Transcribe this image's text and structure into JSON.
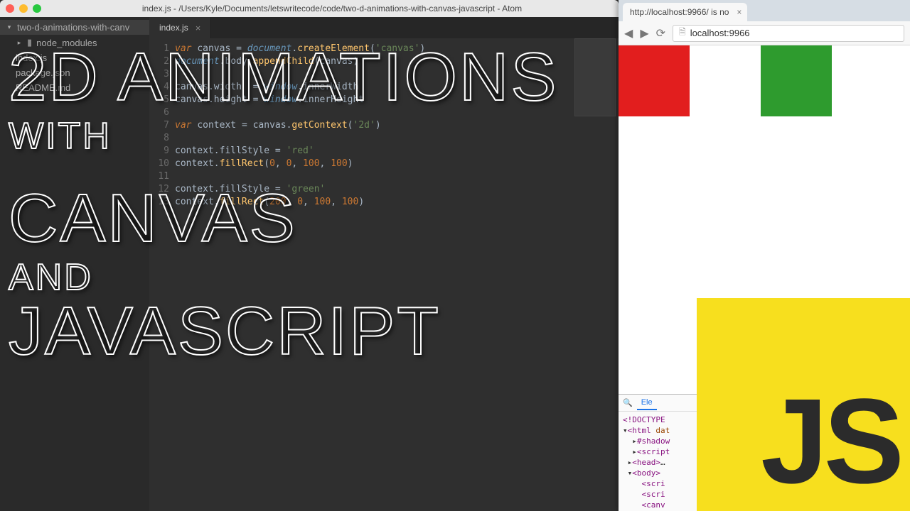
{
  "atom": {
    "title": "index.js - /Users/Kyle/Documents/letswritecode/code/two-d-animations-with-canvas-javascript - Atom",
    "sidebar": {
      "project": "two-d-animations-with-canv",
      "items": [
        {
          "name": "node_modules",
          "type": "folder"
        },
        {
          "name": "index.js",
          "type": "file"
        },
        {
          "name": "package.json",
          "type": "file"
        },
        {
          "name": "README.md",
          "type": "file"
        }
      ]
    },
    "tab": {
      "name": "index.js",
      "close": "×"
    },
    "code_lines": [
      "var canvas = document.createElement('canvas')",
      "document.body.appendChild(canvas)",
      "",
      "canvas.width  = window.innerWidth",
      "canvas.height = window.innerHeight",
      "",
      "var context = canvas.getContext('2d')",
      "",
      "context.fillStyle = 'red'",
      "context.fillRect(0, 0, 100, 100)",
      "",
      "context.fillStyle = 'green'",
      "context.fillRect(200, 0, 100, 100)"
    ]
  },
  "chrome": {
    "tab_label": "http://localhost:9966/ is no",
    "tab_close": "×",
    "url_display": "localhost:9966",
    "devtools": {
      "icon_search": "🔍",
      "tab_elements": "Ele",
      "lines": [
        "<!DOCTYPE",
        "▾<html dat",
        "  ▸#shadow",
        "  ▸<script",
        " ▸<head>…",
        " ▾<body>",
        "    <scri",
        "    <scri",
        "    <canv"
      ]
    }
  },
  "overlay": {
    "l1": "2D ANIMATIONS",
    "l2": "WITH",
    "l3": "CANVAS",
    "l4": "AND",
    "l5": "JAVASCRIPT"
  },
  "js_logo": "JS"
}
